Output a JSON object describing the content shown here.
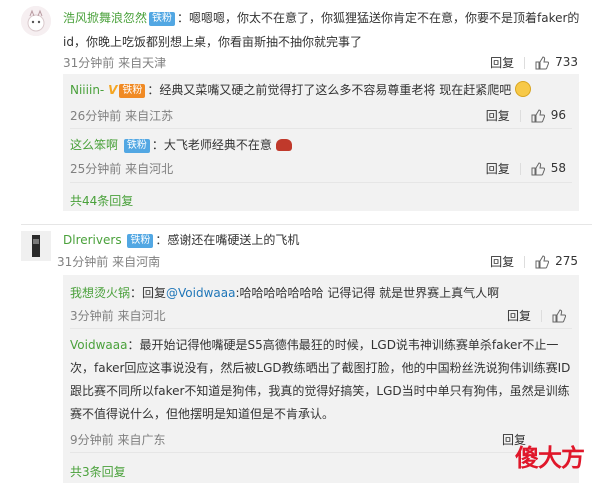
{
  "c1": {
    "name": "浩风掀舞浪忽然",
    "badge": "铁粉",
    "text": "：嗯嗯嗯，你太不在意了，你狐狸猛送你肯定不在意，你要不是顶着faker的id，你晚上吃饭都别想上桌，你看亩斯抽不抽你就完事了",
    "time": "31分钟前 来自天津",
    "reply": "回复",
    "likes": "733",
    "replies": [
      {
        "name": "Niiiin-",
        "vip": "V",
        "badge": "铁粉",
        "text": "：经典又菜嘴又硬之前觉得打了这么多不容易尊重老将 现在赶紧爬吧",
        "emoji": "smile",
        "time": "26分钟前 来自江苏",
        "reply": "回复",
        "likes": "96"
      },
      {
        "name": "这么笨啊",
        "badge": "铁粉",
        "text": "：大飞老师经典不在意",
        "emoji": "pot",
        "time": "25分钟前 来自河北",
        "reply": "回复",
        "likes": "58"
      }
    ],
    "more": "共44条回复"
  },
  "c2": {
    "name": "Dlrerivers",
    "badge": "铁粉",
    "text": "：感谢还在嘴硬送上的飞机",
    "time": "31分钟前 来自河南",
    "reply": "回复",
    "likes": "275",
    "replies": [
      {
        "name": "我想烫火锅",
        "text_pre": "：回复",
        "mention": "@Voidwaaa",
        "text": ":哈哈哈哈哈哈哈 记得记得 就是世界赛上真气人啊",
        "time": "3分钟前 来自河北",
        "reply": "回复"
      },
      {
        "name": "Voidwaaa",
        "line1": "：最开始记得他嘴硬是S5高德伟最狂的时候，LGD说韦神训练赛单杀faker不止一",
        "line2": "次，faker回应这事说没有，然后被LGD教练晒出了截图打脸，他的中国粉丝洗说狗伟训练赛ID",
        "line3": "跟比赛不同所以faker不知道是狗伟，我真的觉得好搞笑，LGD当时中单只有狗伟，虽然是训练",
        "line4": "赛不值得说什么，但他摆明是知道但是不肯承认。",
        "time": "9分钟前 来自广东",
        "reply": "回复"
      }
    ],
    "more": "共3条回复"
  },
  "watermark": "傻大方"
}
